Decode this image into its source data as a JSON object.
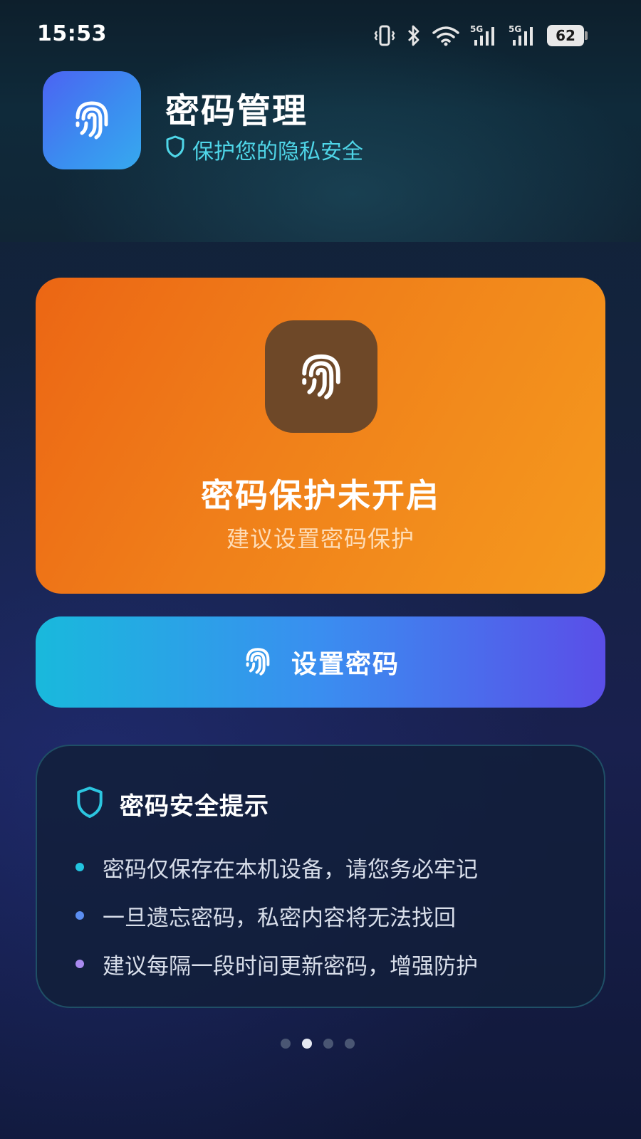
{
  "status_bar": {
    "time": "15:53",
    "icons": [
      "vibrate-icon",
      "bluetooth-icon",
      "wifi-icon",
      "signal-5g-icon",
      "signal-5g-icon"
    ],
    "network_label_1": "5G",
    "network_label_2": "5G",
    "battery": "62"
  },
  "header": {
    "title": "密码管理",
    "subtitle": "保护您的隐私安全",
    "logo_icon": "fingerprint-icon",
    "subtitle_icon": "shield-icon"
  },
  "status_card": {
    "icon": "fingerprint-icon",
    "title": "密码保护未开启",
    "subtitle": "建议设置密码保护",
    "color": "#ee7316"
  },
  "set_button": {
    "icon": "fingerprint-icon",
    "label": "设置密码"
  },
  "tips": {
    "icon": "shield-icon",
    "title": "密码安全提示",
    "items": [
      {
        "text": "密码仅保存在本机设备，请您务必牢记",
        "dot_color": "#22c4e0"
      },
      {
        "text": "一旦遗忘密码，私密内容将无法找回",
        "dot_color": "#5b8ef2"
      },
      {
        "text": "建议每隔一段时间更新密码，增强防护",
        "dot_color": "#a98af0"
      }
    ]
  },
  "pager": {
    "count": 4,
    "active_index": 1
  },
  "colors": {
    "accent_cyan": "#4fd6e8",
    "button_start": "#19b9dc",
    "button_end": "#5a4ee8"
  }
}
